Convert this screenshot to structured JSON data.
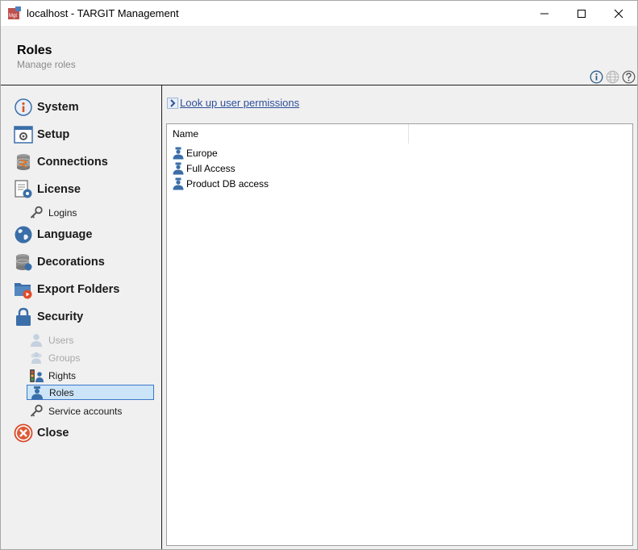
{
  "window": {
    "title": "localhost - TARGIT Management",
    "app_icon_text": "Mgt"
  },
  "header": {
    "title": "Roles",
    "subtitle": "Manage roles"
  },
  "sidebar": {
    "items": [
      {
        "label": "System",
        "icon": "info-icon"
      },
      {
        "label": "Setup",
        "icon": "setup-icon"
      },
      {
        "label": "Connections",
        "icon": "database-icon"
      },
      {
        "label": "License",
        "icon": "license-icon"
      },
      {
        "label": "Language",
        "icon": "globe-icon"
      },
      {
        "label": "Decorations",
        "icon": "decorations-icon"
      },
      {
        "label": "Export Folders",
        "icon": "export-folder-icon"
      },
      {
        "label": "Security",
        "icon": "lock-icon"
      },
      {
        "label": "Close",
        "icon": "close-circle-icon"
      }
    ],
    "license_sub": [
      {
        "label": "Logins",
        "icon": "key-icon"
      }
    ],
    "security_sub": [
      {
        "label": "Users",
        "icon": "user-icon",
        "disabled": true
      },
      {
        "label": "Groups",
        "icon": "group-icon",
        "disabled": true
      },
      {
        "label": "Rights",
        "icon": "rights-icon",
        "disabled": false
      },
      {
        "label": "Roles",
        "icon": "role-icon",
        "selected": true
      },
      {
        "label": "Service accounts",
        "icon": "key-icon",
        "disabled": false
      }
    ]
  },
  "content": {
    "lookup_link": "Look up user permissions",
    "columns": [
      "Name"
    ],
    "rows": [
      "Europe",
      "Full Access",
      "Product DB access"
    ]
  },
  "colors": {
    "accent": "#3b78c9",
    "selected_bg": "#cce4f7",
    "link": "#2d4f9b",
    "role_icon": "#3a6ea8"
  }
}
